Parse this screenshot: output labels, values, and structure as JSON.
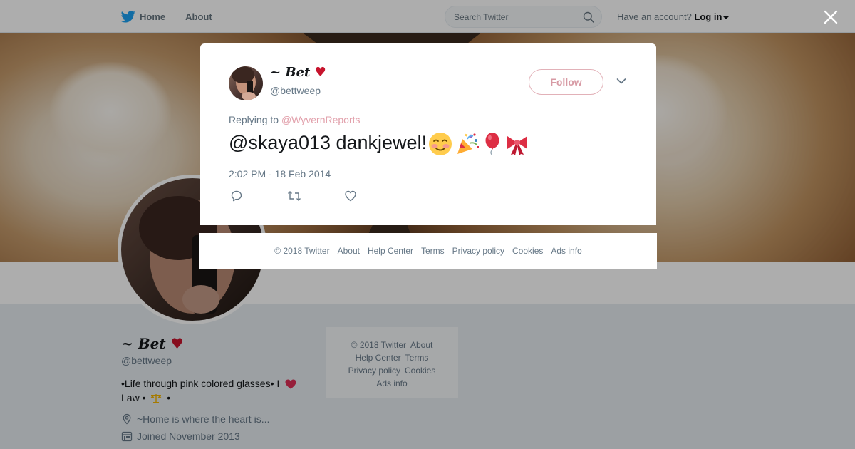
{
  "navbar": {
    "home_label": "Home",
    "about_label": "About",
    "search_placeholder": "Search Twitter",
    "account_prompt": "Have an account?",
    "login_label": "Log in"
  },
  "profile": {
    "display_name": "~ 𝑩𝒆𝒕",
    "heart": "♥",
    "screen_name": "@bettweep",
    "bio_line1": "•Life through pink colored glasses• I",
    "bio_line2": "Law •",
    "bio_end": "•",
    "location": "~Home is where the heart is...",
    "joined": "Joined November 2013"
  },
  "side_footer": {
    "copyright": "© 2018 Twitter",
    "about": "About",
    "help": "Help Center",
    "terms": "Terms",
    "privacy": "Privacy policy",
    "cookies": "Cookies",
    "ads": "Ads info"
  },
  "modal": {
    "display_name": "~ 𝑩𝒆𝒕",
    "heart": "♥",
    "handle": "@bettweep",
    "follow_label": "Follow",
    "replying_prefix": "Replying to",
    "replying_to": "@WyvernReports",
    "tweet_text": "@skaya013 dankjewel!",
    "timestamp": "2:02 PM - 18 Feb 2014"
  },
  "modal_footer": {
    "copyright": "© 2018 Twitter",
    "about": "About",
    "help": "Help Center",
    "terms": "Terms",
    "privacy": "Privacy policy",
    "cookies": "Cookies",
    "ads": "Ads info"
  },
  "colors": {
    "twitter_blue": "#1da1f2",
    "follow_pink": "#d79aa4",
    "reply_link_pink": "#e2a0ab",
    "heart_red": "#c7142d"
  },
  "icons": [
    "twitter-bird-icon",
    "search-icon",
    "close-icon",
    "chevron-down-icon",
    "reply-icon",
    "retweet-icon",
    "like-icon",
    "location-icon",
    "calendar-icon"
  ]
}
